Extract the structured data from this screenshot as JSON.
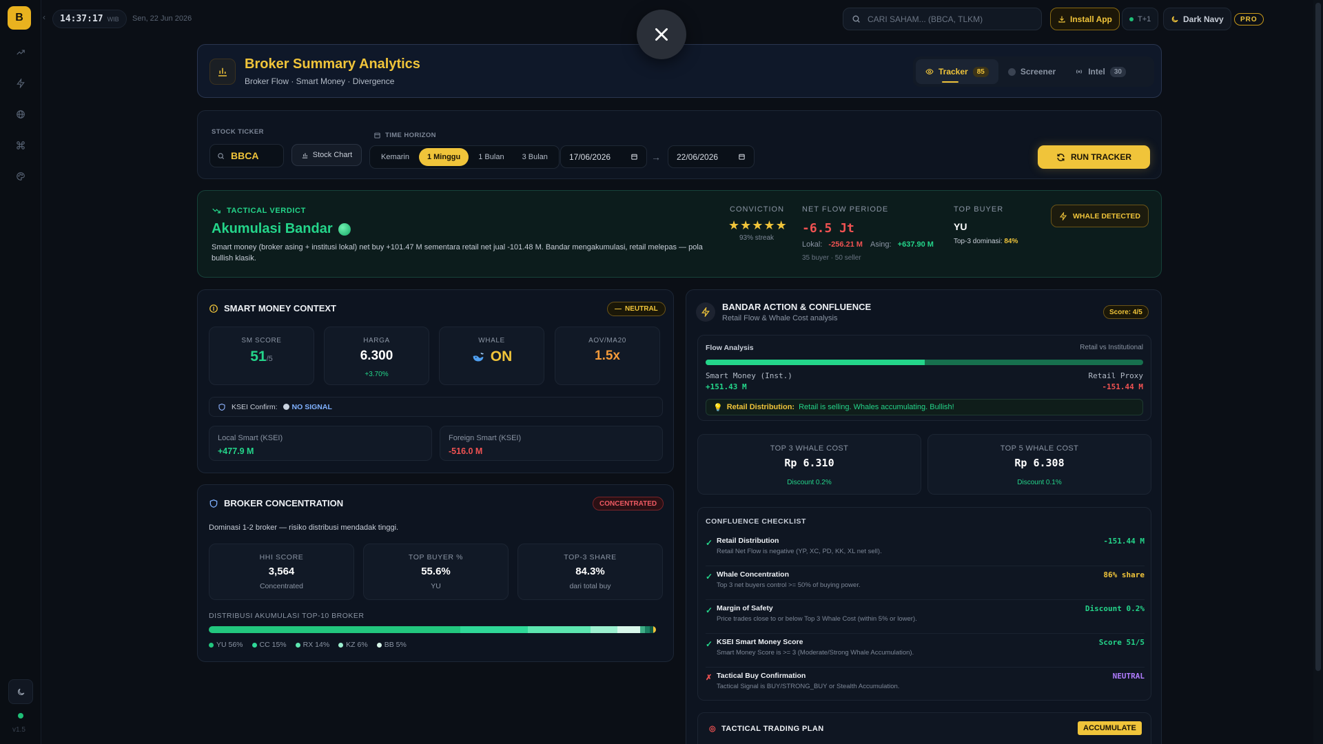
{
  "topbar": {
    "logo_letter": "B",
    "clock_time": "14:37:17",
    "clock_zone": "WIB",
    "date": "Sen, 22 Jun 2026",
    "search_placeholder": "CARI SAHAM... (BBCA, TLKM)",
    "install_label": "Install App",
    "settlement_label": "T+1",
    "theme_label": "Dark Navy",
    "pro_label": "PRO"
  },
  "rail": {
    "version": "v1.5",
    "icons": [
      "trend-icon",
      "lightning-icon",
      "globe-icon",
      "command-icon",
      "palette-icon"
    ]
  },
  "header": {
    "title": "Broker Summary Analytics",
    "subtitle": "Broker Flow · Smart Money · Divergence",
    "tabs": [
      {
        "label": "Tracker",
        "count": "85"
      },
      {
        "label": "Screener",
        "count": ""
      },
      {
        "label": "Intel",
        "count": "30"
      }
    ]
  },
  "controls": {
    "ticker_label": "STOCK TICKER",
    "ticker_value": "BBCA",
    "stock_chart_label": "Stock Chart",
    "horizon_label": "TIME HORIZON",
    "horizons": [
      "Kemarin",
      "1 Minggu",
      "1 Bulan",
      "3 Bulan"
    ],
    "active_horizon": "1 Minggu",
    "date_from": "17/06/2026",
    "date_to": "22/06/2026",
    "arrow": "→",
    "run_label": "RUN TRACKER"
  },
  "verdict": {
    "kicker": "TACTICAL VERDICT",
    "title": "Akumulasi Bandar",
    "description": "Smart money (broker asing + institusi lokal) net buy +101.47 M sementara retail net jual -101.48 M. Bandar mengakumulasi, retail melepas — pola bullish klasik.",
    "conviction_label": "CONVICTION",
    "conviction_stars": 5,
    "streak": "93% streak",
    "net_flow_label": "NET FLOW PERIODE",
    "net_flow_value": "-6.5 Jt",
    "lokal_label": "Lokal:",
    "lokal_value": "-256.21 M",
    "asing_label": "Asing:",
    "asing_value": "+637.90 M",
    "counts": "35 buyer · 50 seller",
    "top_buyer_label": "TOP BUYER",
    "top_buyer_value": "YU",
    "top3_label": "Top-3 dominasi:",
    "top3_value": "84%",
    "whale_badge": "WHALE DETECTED"
  },
  "smart_money": {
    "title": "SMART MONEY CONTEXT",
    "badge": "NEUTRAL",
    "tiles": [
      {
        "label": "SM SCORE",
        "value": "51",
        "suffix": "/5",
        "sub": ""
      },
      {
        "label": "HARGA",
        "value": "6.300",
        "suffix": "",
        "sub": "+3.70%"
      },
      {
        "label": "WHALE",
        "value": "ON",
        "suffix": "",
        "sub": ""
      },
      {
        "label": "AOV/MA20",
        "value": "1.5x",
        "suffix": "",
        "sub": ""
      }
    ],
    "ksei_label": "KSEI Confirm:",
    "ksei_value": "NO SIGNAL",
    "local_label": "Local Smart (KSEI)",
    "local_value": "+477.9 M",
    "foreign_label": "Foreign Smart (KSEI)",
    "foreign_value": "-516.0 M"
  },
  "broker_concentration": {
    "title": "BROKER CONCENTRATION",
    "badge": "CONCENTRATED",
    "description": "Dominasi 1-2 broker — risiko distribusi mendadak tinggi.",
    "tiles": [
      {
        "label": "HHI SCORE",
        "value": "3,564",
        "sub": "Concentrated"
      },
      {
        "label": "TOP BUYER %",
        "value": "55.6%",
        "sub": "YU"
      },
      {
        "label": "TOP-3 SHARE",
        "value": "84.3%",
        "sub": "dari total buy"
      }
    ],
    "dist_label": "DISTRIBUSI AKUMULASI TOP-10 BROKER",
    "distribution": [
      {
        "code": "YU",
        "pct": 56,
        "label": "YU 56%",
        "color": "#22c77e"
      },
      {
        "code": "CC",
        "pct": 15,
        "label": "CC 15%",
        "color": "#2fd898"
      },
      {
        "code": "RX",
        "pct": 14,
        "label": "RX 14%",
        "color": "#5de6b0"
      },
      {
        "code": "KZ",
        "pct": 6,
        "label": "KZ 6%",
        "color": "#9cf0cf"
      },
      {
        "code": "BB",
        "pct": 5,
        "label": "BB 5%",
        "color": "#d8f7ea"
      },
      {
        "code": "",
        "pct": 1.2,
        "label": "",
        "color": "#3fae86"
      },
      {
        "code": "",
        "pct": 1,
        "label": "",
        "color": "#1a7f61"
      },
      {
        "code": "",
        "pct": 0.8,
        "label": "",
        "color": "#0f5a47"
      },
      {
        "code": "",
        "pct": 0.6,
        "label": "",
        "color": "#f0c43a"
      }
    ]
  },
  "bandar": {
    "title": "BANDAR ACTION & CONFLUENCE",
    "subtitle": "Retail Flow & Whale Cost analysis",
    "score_badge": "Score: 4/5",
    "flow_title": "Flow Analysis",
    "flow_right": "Retail vs Institutional",
    "smart_share": 0.5,
    "smart_label": "Smart Money (Inst.)",
    "smart_value": "+151.43 M",
    "retail_label": "Retail Proxy",
    "retail_value": "-151.44 M",
    "alert_bold": "Retail Distribution:",
    "alert_text": "Retail is selling. Whales accumulating. Bullish!",
    "whale_costs": [
      {
        "label": "TOP 3 WHALE COST",
        "value": "Rp 6.310",
        "sub": "Discount 0.2%"
      },
      {
        "label": "TOP 5 WHALE COST",
        "value": "Rp 6.308",
        "sub": "Discount 0.1%"
      }
    ],
    "checklist_title": "CONFLUENCE CHECKLIST",
    "checklist": [
      {
        "name": "Retail Distribution",
        "desc": "Retail Net Flow is negative (YP, XC, PD, KK, XL net sell).",
        "value": "-151.44 M",
        "ok": true,
        "color": "#24d58a"
      },
      {
        "name": "Whale Concentration",
        "desc": "Top 3 net buyers control >= 50% of buying power.",
        "value": "86% share",
        "ok": true,
        "color": "#f0c43a"
      },
      {
        "name": "Margin of Safety",
        "desc": "Price trades close to or below Top 3 Whale Cost (within 5% or lower).",
        "value": "Discount 0.2%",
        "ok": true,
        "color": "#24d58a"
      },
      {
        "name": "KSEI Smart Money Score",
        "desc": "Smart Money Score is >= 3 (Moderate/Strong Whale Accumulation).",
        "value": "Score 51/5",
        "ok": true,
        "color": "#24d58a"
      },
      {
        "name": "Tactical Buy Confirmation",
        "desc": "Tactical Signal is BUY/STRONG_BUY or Stealth Accumulation.",
        "value": "NEUTRAL",
        "ok": false,
        "color": "#b07cff"
      }
    ],
    "plan_title": "TACTICAL TRADING PLAN",
    "plan_badge": "ACCUMULATE"
  },
  "colors": {
    "gold": "#f0c43a",
    "green": "#24d58a",
    "red": "#f05252",
    "bg": "#0b0f16"
  }
}
